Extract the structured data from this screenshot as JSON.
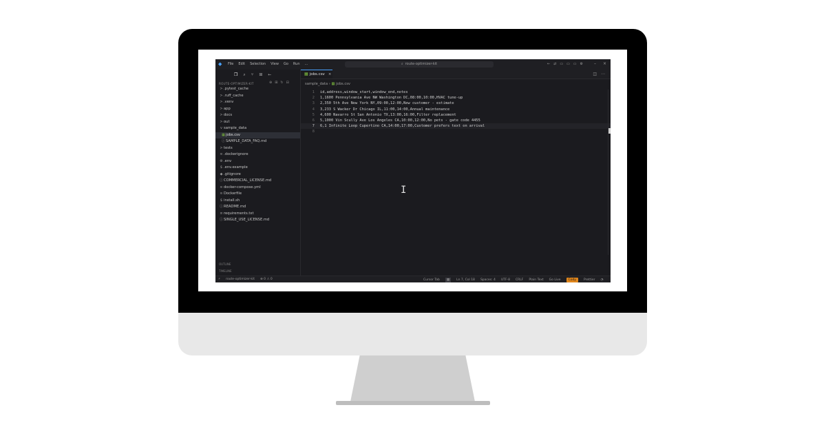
{
  "titlebar": {
    "menu": [
      "File",
      "Edit",
      "Selection",
      "View",
      "Go",
      "Run",
      "..."
    ],
    "search": "route-optimizer-kit"
  },
  "sidebar": {
    "header": "ROUTE-OPTIMIZER-KIT",
    "items": [
      {
        "label": ".pytest_cache",
        "glyph": ">"
      },
      {
        "label": ".ruff_cache",
        "glyph": ">"
      },
      {
        "label": ".venv",
        "glyph": ">"
      },
      {
        "label": "app",
        "glyph": ">"
      },
      {
        "label": "docs",
        "glyph": ">"
      },
      {
        "label": "out",
        "glyph": ">"
      },
      {
        "label": "sample_data",
        "glyph": "v"
      },
      {
        "label": "jobs.csv",
        "glyph": "▦"
      },
      {
        "label": "SAMPLE_DATA_FAQ.md",
        "glyph": "ⓘ"
      },
      {
        "label": "tests",
        "glyph": ">"
      },
      {
        "label": ".dockerignore",
        "glyph": "≋"
      },
      {
        "label": ".env",
        "glyph": "⚙"
      },
      {
        "label": ".env.example",
        "glyph": "$"
      },
      {
        "label": ".gitignore",
        "glyph": "◆"
      },
      {
        "label": "COMMERCIAL_LICENSE.md",
        "glyph": "ⓘ"
      },
      {
        "label": "docker-compose.yml",
        "glyph": "≋"
      },
      {
        "label": "Dockerfile",
        "glyph": "≋"
      },
      {
        "label": "install.sh",
        "glyph": "$"
      },
      {
        "label": "README.md",
        "glyph": "ⓘ"
      },
      {
        "label": "requirements.txt",
        "glyph": "≡"
      },
      {
        "label": "SINGLE_USE_LICENSE.md",
        "glyph": "ⓘ"
      }
    ],
    "outline": "OUTLINE",
    "timeline": "TIMELINE"
  },
  "editor": {
    "tab": "jobs.csv",
    "breadcrumb_folder": "sample_data",
    "breadcrumb_file": "jobs.csv",
    "lines": [
      {
        "n": "1",
        "text": "id,address,window_start,window_end,notes"
      },
      {
        "n": "2",
        "text": "1,1600 Pennsylvania Ave NW Washington DC,08:00,10:00,HVAC tune-up"
      },
      {
        "n": "3",
        "text": "2,350 5th Ave New York NY,09:00,12:00,New customer - estimate"
      },
      {
        "n": "4",
        "text": "3,233 S Wacker Dr Chicago IL,11:00,14:00,Annual maintenance"
      },
      {
        "n": "5",
        "text": "4,600 Navarro St San Antonio TX,13:00,16:00,Filter replacement"
      },
      {
        "n": "6",
        "text": "5,1000 Vin Scully Ave Los Angeles CA,10:00,12:00,No pets - gate code 4455"
      },
      {
        "n": "7",
        "text": "6,1 Infinite Loop Cupertino CA,14:00,17:00,Customer prefers text on arrival"
      },
      {
        "n": "8",
        "text": ""
      }
    ]
  },
  "statusbar": {
    "branch": "route-optimizer-kit",
    "problems": "⊗ 0  ⚠ 0",
    "items": [
      "Cursor Tab",
      "Ln 7, Col 18",
      "Spaces: 4",
      "UTF-8",
      "CRLF",
      "Plain Text",
      "Go Live",
      "Prettier"
    ],
    "badge": "Cody"
  }
}
